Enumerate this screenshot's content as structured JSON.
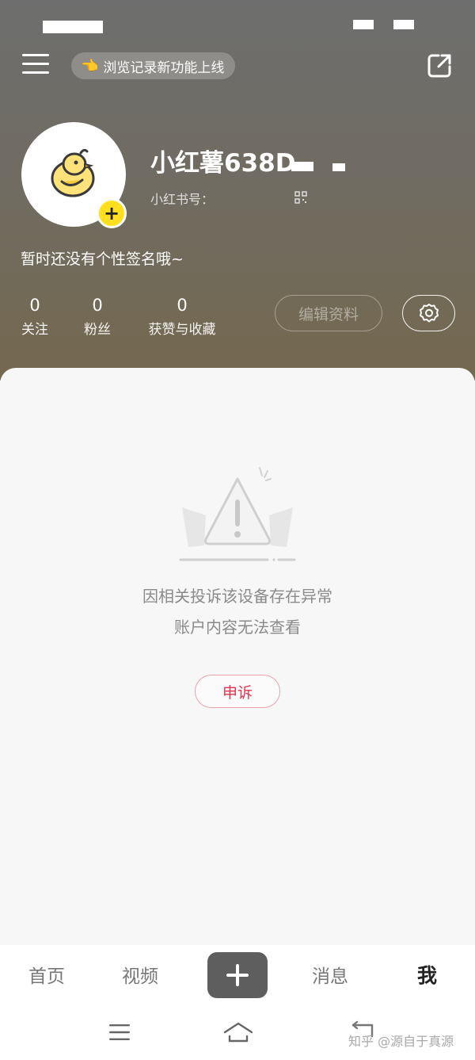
{
  "header": {
    "notice_text": "浏览记录新功能上线",
    "notice_icon": "pointing-hand"
  },
  "profile": {
    "username": "小红薯638D",
    "id_label": "小红书号：",
    "bio": "暂时还没有个性签名哦~",
    "stats": [
      {
        "value": "0",
        "label": "关注"
      },
      {
        "value": "0",
        "label": "粉丝"
      },
      {
        "value": "0",
        "label": "获赞与收藏"
      }
    ],
    "edit_label": "编辑资料"
  },
  "content": {
    "message_line1": "因相关投诉该设备存在异常",
    "message_line2": "账户内容无法查看",
    "appeal_label": "申诉"
  },
  "tabbar": {
    "home": "首页",
    "video": "视频",
    "messages": "消息",
    "me": "我"
  },
  "watermark": "知乎 @源自于真源",
  "colors": {
    "accent": "#e3334f",
    "avatar_badge": "#ffdf1f",
    "publish_button": "#5e5e5e"
  }
}
